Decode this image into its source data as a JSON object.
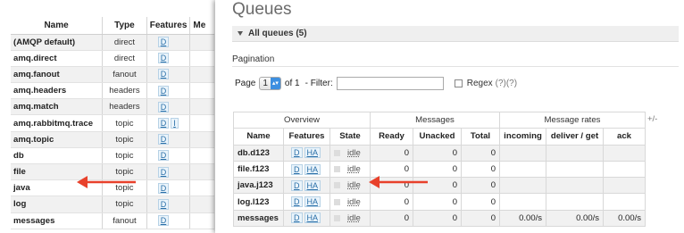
{
  "exchanges": {
    "headers": {
      "name": "Name",
      "type": "Type",
      "features": "Features",
      "messages": "Me"
    },
    "rows": [
      {
        "name": "(AMQP default)",
        "type": "direct",
        "features": [
          "D"
        ]
      },
      {
        "name": "amq.direct",
        "type": "direct",
        "features": [
          "D"
        ]
      },
      {
        "name": "amq.fanout",
        "type": "fanout",
        "features": [
          "D"
        ]
      },
      {
        "name": "amq.headers",
        "type": "headers",
        "features": [
          "D"
        ]
      },
      {
        "name": "amq.match",
        "type": "headers",
        "features": [
          "D"
        ]
      },
      {
        "name": "amq.rabbitmq.trace",
        "type": "topic",
        "features": [
          "D",
          "I"
        ]
      },
      {
        "name": "amq.topic",
        "type": "topic",
        "features": [
          "D"
        ]
      },
      {
        "name": "db",
        "type": "topic",
        "features": [
          "D"
        ]
      },
      {
        "name": "file",
        "type": "topic",
        "features": [
          "D"
        ]
      },
      {
        "name": "java",
        "type": "topic",
        "features": [
          "D"
        ]
      },
      {
        "name": "log",
        "type": "topic",
        "features": [
          "D"
        ]
      },
      {
        "name": "messages",
        "type": "fanout",
        "features": [
          "D"
        ]
      }
    ]
  },
  "queues_page": {
    "title": "Queues",
    "section_label": "All queues (5)",
    "pagination_title": "Pagination",
    "page_label": "Page",
    "page_value": "1",
    "of_label": "of 1",
    "filter_label": "- Filter:",
    "filter_value": "",
    "regex_label": "Regex",
    "regex_help": "(?)(?)",
    "plus_minus": "+/-",
    "group_headers": {
      "overview": "Overview",
      "messages": "Messages",
      "rates": "Message rates"
    },
    "columns": {
      "name": "Name",
      "features": "Features",
      "state": "State",
      "ready": "Ready",
      "unacked": "Unacked",
      "total": "Total",
      "incoming": "incoming",
      "deliver_get": "deliver / get",
      "ack": "ack"
    },
    "rows": [
      {
        "name": "db.d123",
        "features": [
          "D",
          "HA"
        ],
        "state": "idle",
        "ready": "0",
        "unacked": "0",
        "total": "0",
        "incoming": "",
        "deliver_get": "",
        "ack": ""
      },
      {
        "name": "file.f123",
        "features": [
          "D",
          "HA"
        ],
        "state": "idle",
        "ready": "0",
        "unacked": "0",
        "total": "0",
        "incoming": "",
        "deliver_get": "",
        "ack": ""
      },
      {
        "name": "java.j123",
        "features": [
          "D",
          "HA"
        ],
        "state": "idle",
        "ready": "0",
        "unacked": "0",
        "total": "0",
        "incoming": "",
        "deliver_get": "",
        "ack": ""
      },
      {
        "name": "log.l123",
        "features": [
          "D",
          "HA"
        ],
        "state": "idle",
        "ready": "0",
        "unacked": "0",
        "total": "0",
        "incoming": "",
        "deliver_get": "",
        "ack": ""
      },
      {
        "name": "messages",
        "features": [
          "D",
          "HA"
        ],
        "state": "idle",
        "ready": "0",
        "unacked": "0",
        "total": "0",
        "incoming": "0.00/s",
        "deliver_get": "0.00/s",
        "ack": "0.00/s"
      }
    ]
  },
  "colors": {
    "arrow": "#e8412b",
    "tag_text": "#2a6fa8",
    "row_alt": "#f1f1f1"
  }
}
